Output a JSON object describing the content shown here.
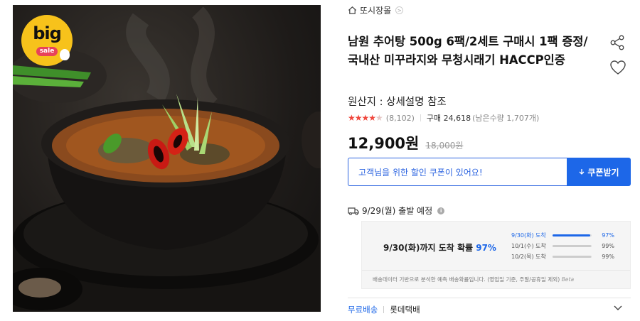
{
  "product_image": {
    "badge_big": "big",
    "badge_sale": "sale"
  },
  "store": {
    "name": "또시장몰",
    "chevron": ">"
  },
  "product": {
    "title": "남원 추어탕 500g 6팩/2세트 구매시 1팩 증정/국내산 미꾸라지와 무청시래기 HACCP인증",
    "origin": "원산지 : 상세설명 참조",
    "rating_stars": 4.5,
    "review_count": "(8,102)",
    "purchase_count": "구매 24,618",
    "remaining": "(남은수량 1,707개)",
    "price": "12,900원",
    "original_price": "18,000원"
  },
  "coupon": {
    "message": "고객님을 위한 할인 쿠폰이 있어요!",
    "button_label": "쿠폰받기"
  },
  "shipping": {
    "ship_date": "9/29(월) 출발 예정",
    "arrival_text": "9/30(화)까지 도착 확률",
    "arrival_pct": "97%",
    "breakdown": [
      {
        "date": "9/30(화) 도착",
        "pct_label": "97%",
        "pct": 97
      },
      {
        "date": "10/1(수) 도착",
        "pct_label": "99%",
        "pct": 99
      },
      {
        "date": "10/2(목) 도착",
        "pct_label": "99%",
        "pct": 99
      }
    ],
    "note": "배송데이터 기반으로 분석한 예측 배송확률입니다. (영업일 기준, 주말/공휴일 제외)",
    "beta": "Beta",
    "free_shipping": "무료배송",
    "carrier": "롯데택배"
  },
  "colors": {
    "accent": "#1d67e8",
    "star": "#f0463c",
    "badge": "#f7c21b"
  }
}
